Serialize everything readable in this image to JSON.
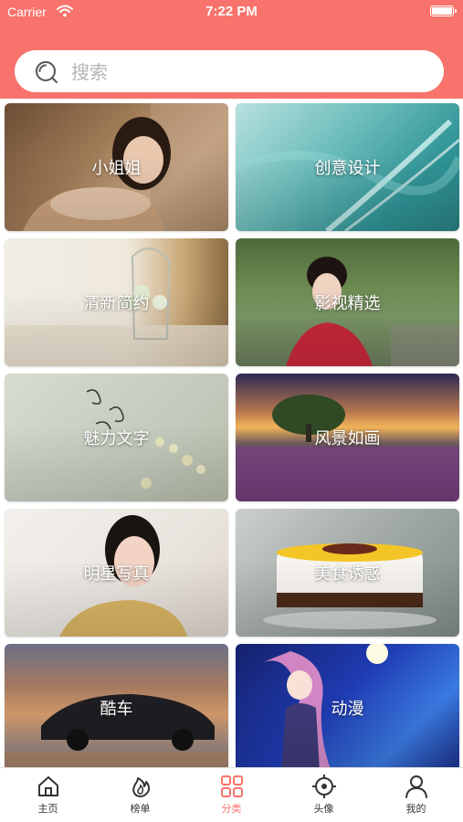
{
  "status_bar": {
    "carrier": "Carrier",
    "time": "7:22 PM"
  },
  "search": {
    "placeholder": "搜索"
  },
  "categories": [
    {
      "label": "小姐姐"
    },
    {
      "label": "创意设计"
    },
    {
      "label": "清新简约"
    },
    {
      "label": "影视精选"
    },
    {
      "label": "魅力文字"
    },
    {
      "label": "风景如画"
    },
    {
      "label": "明星写真"
    },
    {
      "label": "美食诱惑"
    },
    {
      "label": "酷车"
    },
    {
      "label": "动漫"
    }
  ],
  "tabbar": {
    "items": [
      {
        "label": "主页",
        "icon": "home-icon"
      },
      {
        "label": "榜单",
        "icon": "flame-icon"
      },
      {
        "label": "分类",
        "icon": "grid-icon",
        "active": true
      },
      {
        "label": "头像",
        "icon": "target-icon"
      },
      {
        "label": "我的",
        "icon": "person-icon"
      }
    ]
  },
  "colors": {
    "accent": "#f8736b",
    "tab_inactive": "#333333"
  }
}
